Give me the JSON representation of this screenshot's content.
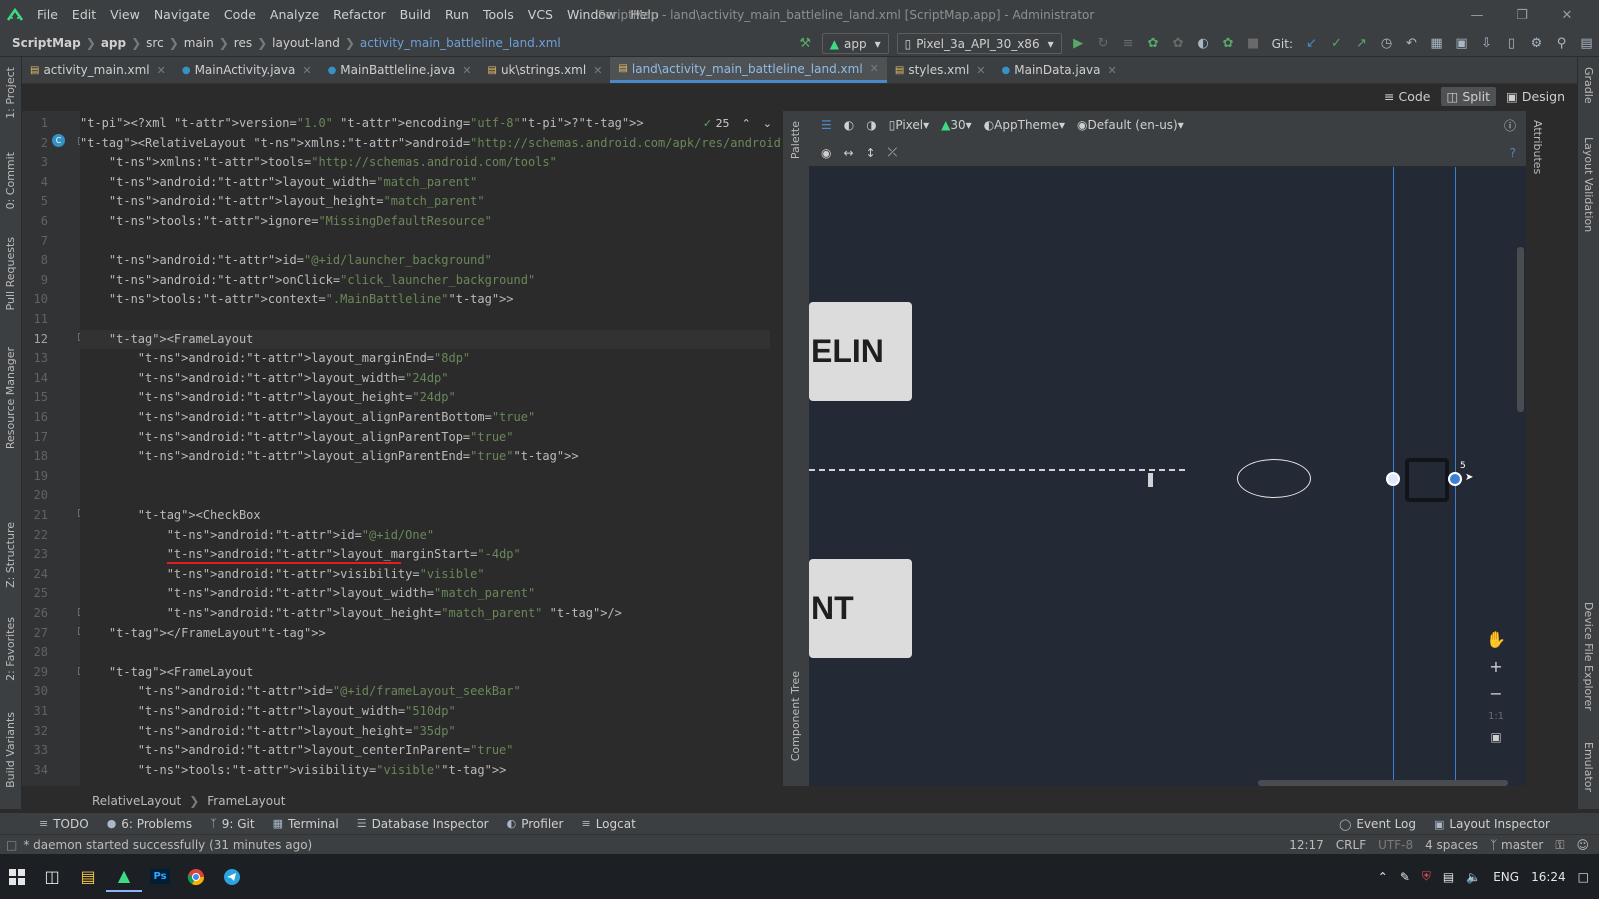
{
  "window": {
    "menu": [
      "File",
      "Edit",
      "View",
      "Navigate",
      "Code",
      "Analyze",
      "Refactor",
      "Build",
      "Run",
      "Tools",
      "VCS",
      "Window",
      "Help"
    ],
    "title": "ScriptMap - land\\activity_main_battleline_land.xml [ScriptMap.app] - Administrator"
  },
  "navbar": {
    "crumbs": [
      "ScriptMap",
      "app",
      "src",
      "main",
      "res",
      "layout-land",
      "activity_main_battleline_land.xml"
    ],
    "run_config": "app",
    "device": "Pixel_3a_API_30_x86",
    "git_label": "Git:"
  },
  "tabs": [
    {
      "label": "activity_main.xml",
      "icon": "xml-file-icon"
    },
    {
      "label": "MainActivity.java",
      "icon": "java-class-icon"
    },
    {
      "label": "MainBattleline.java",
      "icon": "java-class-icon"
    },
    {
      "label": "uk\\strings.xml",
      "icon": "xml-file-icon"
    },
    {
      "label": "land\\activity_main_battleline_land.xml",
      "icon": "xml-file-icon",
      "active": true
    },
    {
      "label": "styles.xml",
      "icon": "xml-file-icon"
    },
    {
      "label": "MainData.java",
      "icon": "java-class-icon"
    }
  ],
  "view_modes": {
    "code": "Code",
    "split": "Split",
    "design": "Design"
  },
  "left_tool_tabs": [
    "1: Project",
    "0: Commit",
    "Pull Requests",
    "Resource Manager",
    "Z: Structure",
    "2: Favorites",
    "Build Variants"
  ],
  "right_tool_tabs": [
    "Gradle",
    "Layout Validation",
    "Device File Explorer",
    "Emulator"
  ],
  "inspection": {
    "count": "25"
  },
  "code_lines": [
    "<?xml version=\"1.0\" encoding=\"utf-8\"?>",
    "<RelativeLayout xmlns:android=\"http://schemas.android.com/apk/res/android\"",
    "    xmlns:tools=\"http://schemas.android.com/tools\"",
    "    android:layout_width=\"match_parent\"",
    "    android:layout_height=\"match_parent\"",
    "    tools:ignore=\"MissingDefaultResource\"",
    "",
    "    android:id=\"@+id/launcher_background\"",
    "    android:onClick=\"click_launcher_background\"",
    "    tools:context=\".MainBattleline\">",
    "",
    "    <FrameLayout",
    "        android:layout_marginEnd=\"8dp\"",
    "        android:layout_width=\"24dp\"",
    "        android:layout_height=\"24dp\"",
    "        android:layout_alignParentBottom=\"true\"",
    "        android:layout_alignParentTop=\"true\"",
    "        android:layout_alignParentEnd=\"true\">",
    "",
    "",
    "        <CheckBox",
    "            android:id=\"@+id/One\"",
    "            android:layout_marginStart=\"-4dp\"",
    "            android:visibility=\"visible\"",
    "            android:layout_width=\"match_parent\"",
    "            android:layout_height=\"match_parent\" />",
    "    </FrameLayout>",
    "",
    "    <FrameLayout",
    "        android:id=\"@+id/frameLayout_seekBar\"",
    "        android:layout_width=\"510dp\"",
    "        android:layout_height=\"35dp\"",
    "        android:layout_centerInParent=\"true\"",
    "        tools:visibility=\"visible\">"
  ],
  "design_toolbar": {
    "device": "Pixel",
    "api": "30",
    "theme": "AppTheme",
    "locale": "Default (en-us)"
  },
  "palette_labels": {
    "palette": "Palette",
    "component_tree": "Component Tree",
    "attributes": "Attributes"
  },
  "canvas": {
    "top_button_text": "ELIN",
    "bottom_button_text": "NT",
    "constraint_badge": "5"
  },
  "bottom_breadcrumb": [
    "RelativeLayout",
    "FrameLayout"
  ],
  "tool_windows": [
    {
      "label": "TODO",
      "icon": "list-icon"
    },
    {
      "label": "6: Problems",
      "icon": "info-icon"
    },
    {
      "label": "9: Git",
      "icon": "branch-icon"
    },
    {
      "label": "Terminal",
      "icon": "terminal-icon"
    },
    {
      "label": "Database Inspector",
      "icon": "database-icon"
    },
    {
      "label": "Profiler",
      "icon": "profiler-icon"
    },
    {
      "label": "Logcat",
      "icon": "logcat-icon"
    }
  ],
  "tool_windows_right": [
    {
      "label": "Event Log",
      "icon": "event-log-icon"
    },
    {
      "label": "Layout Inspector",
      "icon": "layout-inspector-icon"
    }
  ],
  "status": {
    "message": "* daemon started successfully (31 minutes ago)",
    "position": "12:17",
    "line_sep": "CRLF",
    "encoding": "UTF-8",
    "indent": "4 spaces",
    "branch": "master"
  },
  "taskbar": {
    "language": "ENG",
    "time": "16:24"
  },
  "colors": {
    "accent": "#4a88c7",
    "android_green": "#3ddc84",
    "error_underline": "#e02020"
  }
}
